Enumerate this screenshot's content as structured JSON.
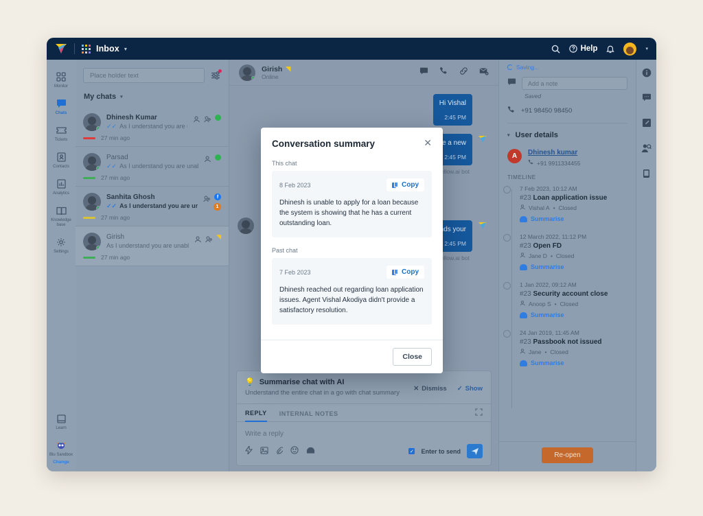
{
  "topbar": {
    "app_icon": "yellow-logo",
    "grid_icon": "apps-grid-icon",
    "inbox_label": "Inbox",
    "caret": "▾",
    "search_icon": "search-icon",
    "help_icon": "help-circle-icon",
    "help_label": "Help",
    "bell_icon": "bell-icon",
    "avatar": "user-avatar",
    "avatar_caret": "▾"
  },
  "rail": {
    "items": [
      {
        "label": "Monitor",
        "icon": "monitor-grid-icon",
        "active": false
      },
      {
        "label": "Chats",
        "icon": "chat-icon",
        "active": true
      },
      {
        "label": "Tickets",
        "icon": "ticket-icon",
        "active": false
      },
      {
        "label": "Contacts",
        "icon": "contacts-icon",
        "active": false
      },
      {
        "label": "Analytics",
        "icon": "analytics-icon",
        "active": false
      },
      {
        "label": "Knowledge base",
        "icon": "book-icon",
        "active": false
      },
      {
        "label": "Settings",
        "icon": "gear-icon",
        "active": false
      }
    ],
    "learn_label": "Learn",
    "learn_icon": "learn-book-icon",
    "bot_icon": "robot-icon",
    "sandbox_label": "Blu Sandbox",
    "change_label": "Change"
  },
  "chatlist": {
    "search_placeholder": "Place holder text",
    "filter_icon": "filter-sliders-icon",
    "heading": "My chats",
    "heading_caret": "▾",
    "items": [
      {
        "name": "Dhinesh Kumar",
        "preview": "As I understand you are unable to...",
        "time": "27 min ago",
        "bar_color": "#e03b3b",
        "bold": false,
        "selected": false,
        "icons": [
          "assign-icon",
          "agent-icon"
        ],
        "status": "online-dot"
      },
      {
        "name": "Parsad",
        "preview": "As I understand you are unable to...",
        "time": "27 min ago",
        "bar_color": "#3fae57",
        "bold": false,
        "selected": false,
        "icons": [
          "assign-icon"
        ],
        "status": "online-dot"
      },
      {
        "name": "Sanhita Ghosh",
        "preview": "As I understand you are una...",
        "time": "27 min ago",
        "bar_color": "#d9c238",
        "bold": true,
        "selected": false,
        "icons": [
          "agent-icon"
        ],
        "status": "facebook-badge",
        "unread": "1"
      },
      {
        "name": "Girish",
        "preview": "As I understand you are unable to us...",
        "time": "27 min ago",
        "bar_color": "#3fae57",
        "bold": false,
        "selected": true,
        "icons": [
          "assign-icon",
          "agent-icon"
        ],
        "status": "yellow-bot-badge"
      }
    ]
  },
  "conversation": {
    "contact_name": "Girish",
    "contact_status": "Online",
    "verified_icon": "yellow-badge-icon",
    "actions": [
      "chat-icon",
      "phone-icon",
      "link-icon",
      "mail-forward-icon"
    ],
    "messages": [
      {
        "text": "Hi Vishal",
        "time": "2:45 PM",
        "byline": ""
      },
      {
        "text": "take a new",
        "time": "2:45 PM",
        "byline": "by yellow.ai bot"
      },
      {
        "text": "live agent. ands your",
        "time": "2:45 PM",
        "byline": "by yellow.ai bot"
      }
    ]
  },
  "ai_banner": {
    "icon": "lightbulb-icon",
    "title": "Summarise chat with AI",
    "subtitle": "Understand the entire chat in a go with chat summary",
    "dismiss_label": "Dismiss",
    "dismiss_icon": "close-x-icon",
    "show_label": "Show",
    "show_icon": "check-icon"
  },
  "composer": {
    "tabs": [
      {
        "label": "REPLY",
        "active": true
      },
      {
        "label": "INTERNAL NOTES",
        "active": false
      }
    ],
    "expand_icon": "expand-icon",
    "placeholder": "Write a reply",
    "tools": [
      "quick-reply-icon",
      "image-icon",
      "attachment-icon",
      "emoji-icon",
      "bot-icon"
    ],
    "enter_to_send_label": "Enter to send",
    "enter_to_send_checked": true,
    "send_icon": "send-icon"
  },
  "rightpanel": {
    "saving_label": "Saving...",
    "saving_icon": "spinner-icon",
    "note_icon": "note-icon",
    "note_placeholder": "Add a note",
    "saved_label": "Saved",
    "phone_icon": "phone-icon",
    "phone": "+91 98450 98450",
    "user_details_label": "User details",
    "user_details_caret": "▾",
    "user_initial": "A",
    "user_name": "Dhinesh kumar",
    "user_phone": "+91 9911334455",
    "timeline_label": "TIMELINE",
    "timeline": [
      {
        "date": "7 Feb 2023, 10:12 AM",
        "id": "#23",
        "title": "Loan application issue",
        "agent": "Vishal A",
        "status": "Closed",
        "summarise_label": "Summarise"
      },
      {
        "date": "12 March 2022, 11:12 PM",
        "id": "#23",
        "title": "Open FD",
        "agent": "Jane D",
        "status": "Closed",
        "summarise_label": "Summarise"
      },
      {
        "date": "1 Jan 2022, 09:12 AM",
        "id": "#23",
        "title": "Security account close",
        "agent": "Anoop S",
        "status": "Closed",
        "summarise_label": "Summarise"
      },
      {
        "date": "24 Jan 2019, 11:45 AM",
        "id": "#23",
        "title": "Passbook not issued",
        "agent": "Jane",
        "status": "Closed",
        "summarise_label": "Summarise"
      }
    ],
    "reopen_label": "Re-open",
    "reopen_color": "#c4682b"
  },
  "farrail": {
    "icons": [
      "info-icon",
      "chat-bubble-icon",
      "edit-note-icon",
      "user-search-icon",
      "device-icon"
    ]
  },
  "modal": {
    "title": "Conversation summary",
    "close_icon": "close-x-icon",
    "sections": [
      {
        "label": "This chat",
        "date": "8 Feb 2023",
        "copy_label": "Copy",
        "copy_icon": "copy-icon",
        "text": "Dhinesh is unable to apply for a loan because the system is showing that he has a current outstanding loan."
      },
      {
        "label": "Past chat",
        "date": "7 Feb 2023",
        "copy_label": "Copy",
        "copy_icon": "copy-icon",
        "text": "Dhinesh reached out regarding loan application issues. Agent Vishal Akodiya didn't provide a satisfactory resolution."
      }
    ],
    "close_button_label": "Close"
  },
  "colors": {
    "page_background": "#f3eee5",
    "navbar": "#0b2545",
    "accent_blue": "#2f7de1",
    "bubble_blue": "#15589c",
    "reopen_orange": "#c4682b",
    "unread_orange": "#e07b1f",
    "online_green": "#2fb350"
  }
}
